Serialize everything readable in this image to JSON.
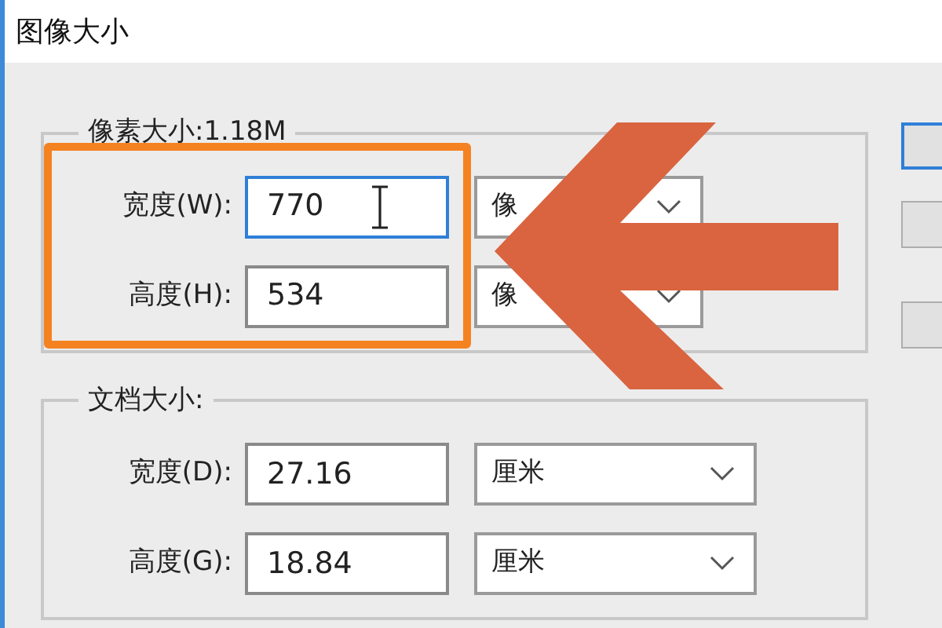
{
  "window": {
    "title": "图像大小"
  },
  "pixel_dimensions": {
    "legend": "像素大小:1.18M",
    "rows": [
      {
        "label": "宽度(W):",
        "value": "770",
        "focused": true,
        "unit": "像"
      },
      {
        "label": "高度(H):",
        "value": "534",
        "focused": false,
        "unit": "像"
      }
    ]
  },
  "document_size": {
    "legend": "文档大小:",
    "rows": [
      {
        "label": "宽度(D):",
        "value": "27.16",
        "focused": false,
        "unit": "厘米"
      },
      {
        "label": "高度(G):",
        "value": "18.84",
        "focused": false,
        "unit": "厘米"
      }
    ]
  },
  "buttons": [
    {
      "default": true
    },
    {
      "default": false
    },
    {
      "default": false
    }
  ]
}
